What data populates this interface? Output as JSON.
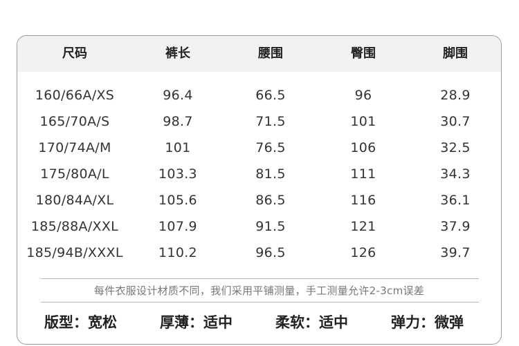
{
  "table": {
    "headers": [
      "尺码",
      "裤长",
      "腰围",
      "臀围",
      "脚围"
    ],
    "rows": [
      [
        "160/66A/XS",
        "96.4",
        "66.5",
        "96",
        "28.9"
      ],
      [
        "165/70A/S",
        "98.7",
        "71.5",
        "101",
        "30.7"
      ],
      [
        "170/74A/M",
        "101",
        "76.5",
        "106",
        "32.5"
      ],
      [
        "175/80A/L",
        "103.3",
        "81.5",
        "111",
        "34.3"
      ],
      [
        "180/84A/XL",
        "105.6",
        "86.5",
        "116",
        "36.1"
      ],
      [
        "185/88A/XXL",
        "107.9",
        "91.5",
        "121",
        "37.9"
      ],
      [
        "185/94B/XXXL",
        "110.2",
        "96.5",
        "126",
        "39.7"
      ]
    ]
  },
  "note": "每件衣服设计材质不同，我们采用平铺测量，手工测量允许2-3cm误差",
  "attributes": [
    {
      "label": "版型：",
      "value": "宽松"
    },
    {
      "label": "厚薄：",
      "value": "适中"
    },
    {
      "label": "柔软：",
      "value": "适中"
    },
    {
      "label": "弹力：",
      "value": "微弹"
    }
  ]
}
